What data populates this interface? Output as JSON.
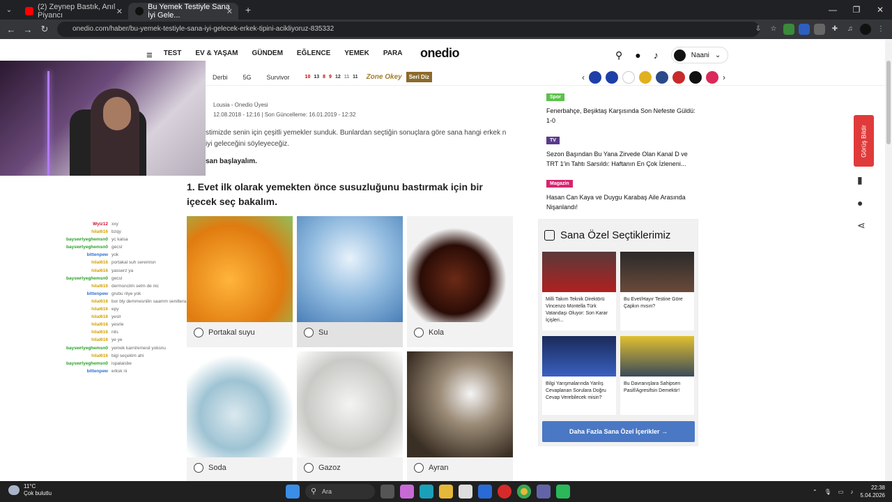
{
  "browser": {
    "tabs": [
      {
        "label": "(2) Zeynep Bastık, Anıl Piyancı",
        "favicon_color": "#ff0000"
      },
      {
        "label": "Bu Yemek Testiyle Sana İyi Gele...",
        "favicon_color": "#111111"
      }
    ],
    "new_tab": "+",
    "url": "onedio.com/haber/bu-yemek-testiyle-sana-iyi-gelecek-erkek-tipini-acikliyoruz-835332"
  },
  "site": {
    "menu_icon": "≡",
    "nav": [
      "TEST",
      "EV & YAŞAM",
      "GÜNDEM",
      "EĞLENCE",
      "YEMEK",
      "PARA"
    ],
    "logo": "onedio",
    "user": "Naani",
    "subnav": [
      "Derbi",
      "5G",
      "Survivor"
    ],
    "scores": [
      "10",
      "13",
      "8",
      "9",
      "12",
      "11",
      "11"
    ],
    "zone": "Zone Okey",
    "seri": "Seri Diz"
  },
  "article": {
    "author": "Lousia - Onedio Üyesi",
    "dates": "12.08.2018 - 12:16  |  Son Güncelleme: 16.01.2019 - 12:32",
    "intro": "stimizde senin için çeşitli yemekler sunduk. Bunlardan seçtiğin sonuçlara göre sana hangi erkek n iyi geleceğini söyleyeceğiz.",
    "intro2": "san başlayalım.",
    "question": "1. Evet ilk olarak yemekten önce susuzluğunu bastırmak için bir içecek seç bakalım.",
    "options": [
      {
        "label": "Portakal suyu",
        "color": "#f2a324"
      },
      {
        "label": "Su",
        "color": "#5b8fc4"
      },
      {
        "label": "Kola",
        "color": "#4a1e12"
      },
      {
        "label": "Soda",
        "color": "#8fb8c9"
      },
      {
        "label": "Gazoz",
        "color": "#c9c9c6"
      },
      {
        "label": "Ayran",
        "color": "#7a6a58"
      }
    ]
  },
  "sidebar": {
    "news": [
      {
        "tag": "Spor",
        "tag_color": "#5cc24a",
        "title": "Fenerbahçe, Beşiktaş Karşısında Son Nefeste Güldü: 1-0"
      },
      {
        "tag": "TV",
        "tag_color": "#5a3a8c",
        "title": "Sezon Başından Bu Yana Zirvede Olan Kanal D ve TRT 1'in Tahtı Sarsıldı: Haftanın En Çok İzleneni..."
      },
      {
        "tag": "Magazin",
        "tag_color": "#d6246e",
        "title": "Hasan Can Kaya ve Duygu Karabaş Aile Arasında Nişanlandı!"
      }
    ],
    "ozel_title": "Sana Özel Seçtiklerimiz",
    "ozel_cards": [
      {
        "title": "Milli Takım Teknik Direktörü Vincenzo Montella Türk Vatandaşı Oluyor: Son Karar İçişleri...",
        "color": "#7a2a2a"
      },
      {
        "title": "Bu Evet/Hayır Testine Göre Çapkın mısın?",
        "color": "#3a3a3a"
      },
      {
        "title": "Bilgi Yarışmalarında Yanlış Cevaplanan Sorulara Doğru Cevap Verebilecek misin?",
        "color": "#1a2a5a"
      },
      {
        "title": "Bu Davranışlara Sahipsen Pasif/Agresifsin Demektir!",
        "color": "#3a4a5a"
      }
    ],
    "more_button": "Daha Fazla Sana Özel İçerikler →",
    "feedback": "Görüş Bildir"
  },
  "chat": [
    {
      "user": "Wyiz12",
      "color": "#c8102e",
      "msg": "xxy"
    },
    {
      "user": "hilal616",
      "color": "#d2a000",
      "msg": "bzqy"
    },
    {
      "user": "bayswrlyeghemsn0",
      "color": "#2aa02a",
      "msg": "yc kalsa"
    },
    {
      "user": "bayswrlyeghemsn0",
      "color": "#2aa02a",
      "msg": "gecsl"
    },
    {
      "user": "bittenpew",
      "color": "#2b6fd1",
      "msg": "yok"
    },
    {
      "user": "hilal616",
      "color": "#d2a000",
      "msg": "portakal suh seremisn"
    },
    {
      "user": "hilal616",
      "color": "#d2a000",
      "msg": "yasserz ya"
    },
    {
      "user": "bayswrlyeghemsn0",
      "color": "#2aa02a",
      "msg": "gecsl"
    },
    {
      "user": "hilal616",
      "color": "#d2a000",
      "msg": "dermsncilm selm de nic"
    },
    {
      "user": "bittenpew",
      "color": "#2b6fd1",
      "msg": "grubu nlye yok"
    },
    {
      "user": "hilal616",
      "color": "#d2a000",
      "msg": "bor bly demmesnilin saamm seniltera"
    },
    {
      "user": "hilal616",
      "color": "#d2a000",
      "msg": "epy"
    },
    {
      "user": "hilal616",
      "color": "#d2a000",
      "msg": "yeslr"
    },
    {
      "user": "hilal616",
      "color": "#d2a000",
      "msg": "yesrle"
    },
    {
      "user": "hilal616",
      "color": "#d2a000",
      "msg": "nils"
    },
    {
      "user": "hilal616",
      "color": "#d2a000",
      "msg": "ye ye"
    },
    {
      "user": "bayswrlyeghemsn0",
      "color": "#2aa02a",
      "msg": "yemek karnl/emesil yoksnu"
    },
    {
      "user": "hilal616",
      "color": "#d2a000",
      "msg": "bigi seçeklm ahi"
    },
    {
      "user": "bayswrlyeghemsn0",
      "color": "#2aa02a",
      "msg": "ispalaisbe"
    },
    {
      "user": "bittenpew",
      "color": "#2b6fd1",
      "msg": "erksk ni"
    }
  ],
  "taskbar": {
    "temp": "11°C",
    "weather": "Çok bulutlu",
    "search": "Ara",
    "time": "22:38",
    "date": "5.04.2026"
  }
}
